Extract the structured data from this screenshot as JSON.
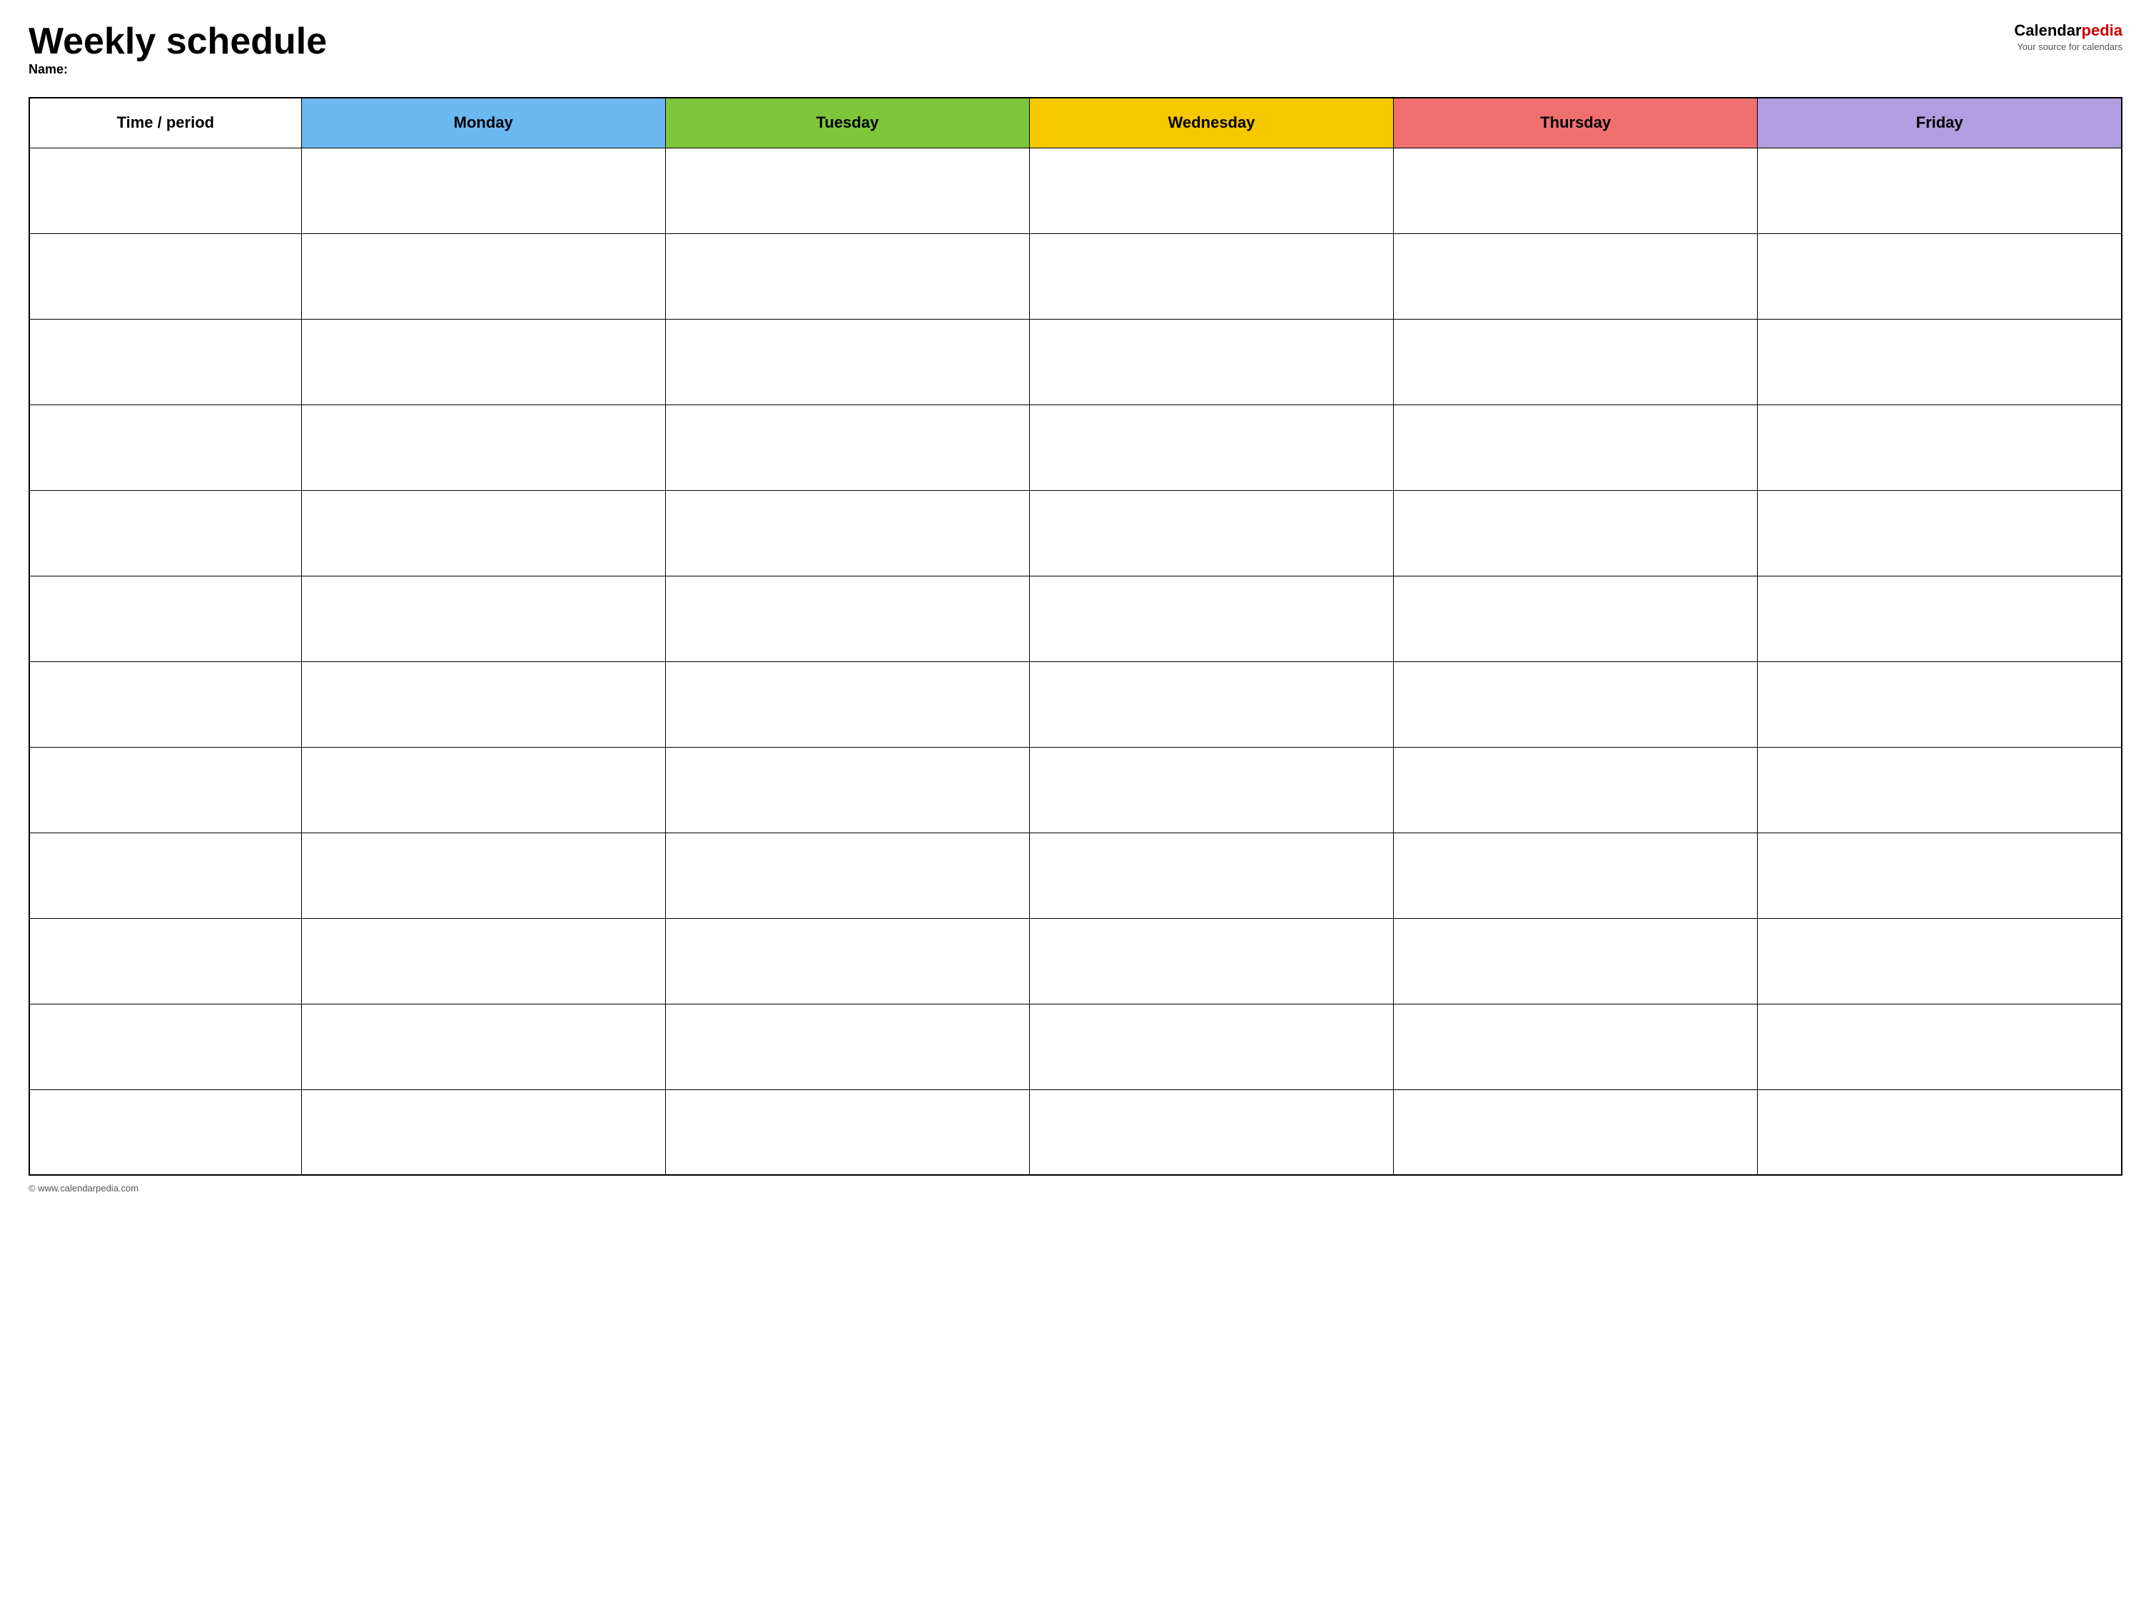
{
  "header": {
    "title": "Weekly schedule",
    "name_label": "Name:",
    "logo_calendar": "Calendar",
    "logo_pedia": "pedia",
    "logo_tagline": "Your source for calendars"
  },
  "table": {
    "columns": [
      {
        "key": "time",
        "label": "Time / period",
        "color": "#ffffff"
      },
      {
        "key": "monday",
        "label": "Monday",
        "color": "#6bb8f0"
      },
      {
        "key": "tuesday",
        "label": "Tuesday",
        "color": "#7dc63b"
      },
      {
        "key": "wednesday",
        "label": "Wednesday",
        "color": "#f5c800"
      },
      {
        "key": "thursday",
        "label": "Thursday",
        "color": "#f07070"
      },
      {
        "key": "friday",
        "label": "Friday",
        "color": "#b09ee0"
      }
    ],
    "row_count": 12
  },
  "footer": {
    "url": "© www.calendarpedia.com"
  }
}
